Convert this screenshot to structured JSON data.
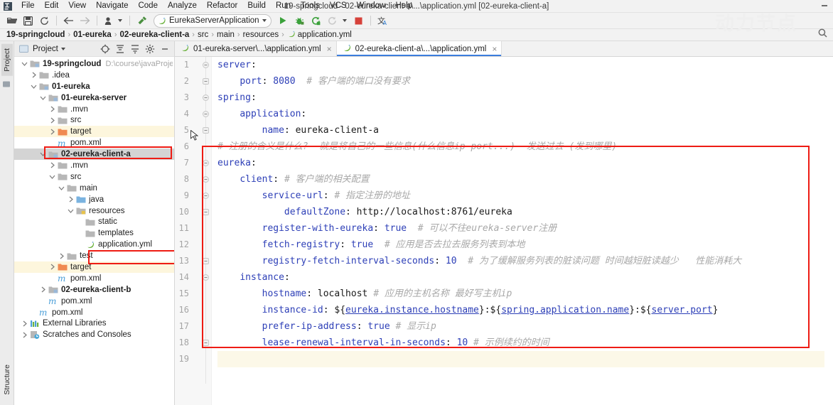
{
  "window": {
    "title": "19-springcloud - 02-eureka-client-a\\...\\application.yml [02-eureka-client-a]",
    "minimize_label": "—"
  },
  "menubar": {
    "items": [
      {
        "label": "File"
      },
      {
        "label": "Edit"
      },
      {
        "label": "View"
      },
      {
        "label": "Navigate"
      },
      {
        "label": "Code"
      },
      {
        "label": "Analyze"
      },
      {
        "label": "Refactor"
      },
      {
        "label": "Build"
      },
      {
        "label": "Run"
      },
      {
        "label": "Tools"
      },
      {
        "label": "VCS"
      },
      {
        "label": "Window"
      },
      {
        "label": "Help"
      }
    ]
  },
  "toolbar": {
    "run_config": "EurekaServerApplication",
    "icons": [
      "open-folder-icon",
      "save-all-icon",
      "sync-icon",
      "back-arrow-icon",
      "forward-arrow-icon",
      "profile-icon",
      "build-hammer-icon",
      "run-icon",
      "debug-icon",
      "run-with-coverage-icon",
      "rerun-icon",
      "stop-icon",
      "translate-icon"
    ]
  },
  "breadcrumb": {
    "items": [
      {
        "label": "19-springcloud",
        "bold": true
      },
      {
        "label": "01-eureka",
        "bold": true
      },
      {
        "label": "02-eureka-client-a",
        "bold": true
      },
      {
        "label": "src",
        "bold": false
      },
      {
        "label": "main",
        "bold": false
      },
      {
        "label": "resources",
        "bold": false
      },
      {
        "label": "application.yml",
        "bold": false,
        "icon": "yml-file-icon"
      }
    ],
    "separator": "›"
  },
  "toolstrip": {
    "project_tab": "Project",
    "structure_tab": "Structure"
  },
  "project_panel": {
    "title": "Project",
    "header_icons": [
      "target-locate-icon",
      "collapse-all-icon",
      "expand-all-icon",
      "gear-icon",
      "minimize-icon"
    ],
    "tree": [
      {
        "indent": 0,
        "arrow": "down",
        "icon": "module-icon",
        "label": "19-springcloud",
        "bold": true,
        "path": "D:\\course\\javaProject\\"
      },
      {
        "indent": 1,
        "arrow": "right",
        "icon": "folder-icon",
        "label": ".idea",
        "bold": false
      },
      {
        "indent": 1,
        "arrow": "down",
        "icon": "module-icon",
        "label": "01-eureka",
        "bold": true
      },
      {
        "indent": 2,
        "arrow": "down",
        "icon": "module-icon",
        "label": "01-eureka-server",
        "bold": true
      },
      {
        "indent": 3,
        "arrow": "right",
        "icon": "folder-icon",
        "label": ".mvn",
        "bold": false
      },
      {
        "indent": 3,
        "arrow": "right",
        "icon": "folder-icon",
        "label": "src",
        "bold": false
      },
      {
        "indent": 3,
        "arrow": "right",
        "icon": "target-folder-icon",
        "label": "target",
        "bold": false,
        "highlight": "yellow"
      },
      {
        "indent": 3,
        "arrow": "none",
        "icon": "maven-icon",
        "label": "pom.xml",
        "bold": false
      },
      {
        "indent": 2,
        "arrow": "down",
        "icon": "module-icon",
        "label": "02-eureka-client-a",
        "bold": true,
        "selected": true
      },
      {
        "indent": 3,
        "arrow": "right",
        "icon": "folder-icon",
        "label": ".mvn",
        "bold": false
      },
      {
        "indent": 3,
        "arrow": "down",
        "icon": "folder-icon",
        "label": "src",
        "bold": false
      },
      {
        "indent": 4,
        "arrow": "down",
        "icon": "folder-icon",
        "label": "main",
        "bold": false
      },
      {
        "indent": 5,
        "arrow": "right",
        "icon": "source-folder-icon",
        "label": "java",
        "bold": false
      },
      {
        "indent": 5,
        "arrow": "down",
        "icon": "resource-folder-icon",
        "label": "resources",
        "bold": false
      },
      {
        "indent": 6,
        "arrow": "none",
        "icon": "folder-icon",
        "label": "static",
        "bold": false
      },
      {
        "indent": 6,
        "arrow": "none",
        "icon": "folder-icon",
        "label": "templates",
        "bold": false
      },
      {
        "indent": 6,
        "arrow": "none",
        "icon": "yml-file-icon",
        "label": "application.yml",
        "bold": false
      },
      {
        "indent": 4,
        "arrow": "right",
        "icon": "folder-icon",
        "label": "test",
        "bold": false
      },
      {
        "indent": 3,
        "arrow": "right",
        "icon": "target-folder-icon",
        "label": "target",
        "bold": false,
        "highlight": "yellow"
      },
      {
        "indent": 3,
        "arrow": "none",
        "icon": "maven-icon",
        "label": "pom.xml",
        "bold": false
      },
      {
        "indent": 2,
        "arrow": "right",
        "icon": "module-icon",
        "label": "02-eureka-client-b",
        "bold": true
      },
      {
        "indent": 2,
        "arrow": "none",
        "icon": "maven-icon",
        "label": "pom.xml",
        "bold": false
      },
      {
        "indent": 1,
        "arrow": "none",
        "icon": "maven-icon",
        "label": "pom.xml",
        "bold": false
      },
      {
        "indent": 0,
        "arrow": "right",
        "icon": "library-icon",
        "label": "External Libraries",
        "bold": false
      },
      {
        "indent": 0,
        "arrow": "right",
        "icon": "scratches-icon",
        "label": "Scratches and Consoles",
        "bold": false
      }
    ]
  },
  "editor": {
    "tabs": [
      {
        "label": "01-eureka-server\\...\\application.yml",
        "icon": "yml-file-icon",
        "active": false,
        "close": "×"
      },
      {
        "label": "02-eureka-client-a\\...\\application.yml",
        "icon": "yml-file-icon",
        "active": true,
        "close": "×"
      }
    ],
    "line_numbers": [
      1,
      2,
      3,
      4,
      5,
      6,
      7,
      8,
      9,
      10,
      11,
      12,
      13,
      14,
      15,
      16,
      17,
      18,
      19
    ],
    "current_line": 19,
    "lines": [
      {
        "n": 1,
        "tokens": [
          {
            "t": "server",
            "c": "k"
          },
          {
            "t": ":",
            "c": "v"
          }
        ]
      },
      {
        "n": 2,
        "tokens": [
          {
            "t": "    ",
            "c": "v"
          },
          {
            "t": "port",
            "c": "k"
          },
          {
            "t": ": ",
            "c": "v"
          },
          {
            "t": "8080",
            "c": "num"
          },
          {
            "t": "  ",
            "c": "v"
          },
          {
            "t": "# ",
            "c": "cmh"
          },
          {
            "t": "客户端的端口没有要求",
            "c": "cm"
          }
        ]
      },
      {
        "n": 3,
        "tokens": [
          {
            "t": "spring",
            "c": "k"
          },
          {
            "t": ":",
            "c": "v"
          }
        ]
      },
      {
        "n": 4,
        "tokens": [
          {
            "t": "    ",
            "c": "v"
          },
          {
            "t": "application",
            "c": "k"
          },
          {
            "t": ":",
            "c": "v"
          }
        ]
      },
      {
        "n": 5,
        "tokens": [
          {
            "t": "        ",
            "c": "v"
          },
          {
            "t": "name",
            "c": "k"
          },
          {
            "t": ": ",
            "c": "v"
          },
          {
            "t": "eureka-client-a",
            "c": "v"
          }
        ]
      },
      {
        "n": 6,
        "tokens": [
          {
            "t": "# ",
            "c": "cmh"
          },
          {
            "t": "注册的含义是什么?  就是将自己的一些信息(什么信息ip port...)  发送过去 (发到哪里)",
            "c": "cm"
          }
        ]
      },
      {
        "n": 7,
        "tokens": [
          {
            "t": "eureka",
            "c": "k"
          },
          {
            "t": ":",
            "c": "v"
          }
        ]
      },
      {
        "n": 8,
        "tokens": [
          {
            "t": "    ",
            "c": "v"
          },
          {
            "t": "client",
            "c": "k"
          },
          {
            "t": ": ",
            "c": "v"
          },
          {
            "t": "# ",
            "c": "cmh"
          },
          {
            "t": "客户端的相关配置",
            "c": "cm"
          }
        ]
      },
      {
        "n": 9,
        "tokens": [
          {
            "t": "        ",
            "c": "v"
          },
          {
            "t": "service-url",
            "c": "k"
          },
          {
            "t": ": ",
            "c": "v"
          },
          {
            "t": "# ",
            "c": "cmh"
          },
          {
            "t": "指定注册的地址",
            "c": "cm"
          }
        ]
      },
      {
        "n": 10,
        "tokens": [
          {
            "t": "            ",
            "c": "v"
          },
          {
            "t": "defaultZone",
            "c": "k"
          },
          {
            "t": ": ",
            "c": "v"
          },
          {
            "t": "http://localhost:8761/eureka",
            "c": "v"
          }
        ]
      },
      {
        "n": 11,
        "tokens": [
          {
            "t": "        ",
            "c": "v"
          },
          {
            "t": "register-with-eureka",
            "c": "k"
          },
          {
            "t": ": ",
            "c": "v"
          },
          {
            "t": "true",
            "c": "num"
          },
          {
            "t": "  ",
            "c": "v"
          },
          {
            "t": "# ",
            "c": "cmh"
          },
          {
            "t": "可以不往eureka-server注册",
            "c": "cm"
          }
        ]
      },
      {
        "n": 12,
        "tokens": [
          {
            "t": "        ",
            "c": "v"
          },
          {
            "t": "fetch-registry",
            "c": "k"
          },
          {
            "t": ": ",
            "c": "v"
          },
          {
            "t": "true",
            "c": "num"
          },
          {
            "t": "  ",
            "c": "v"
          },
          {
            "t": "# ",
            "c": "cmh"
          },
          {
            "t": "应用是否去拉去服务列表到本地",
            "c": "cm"
          }
        ]
      },
      {
        "n": 13,
        "tokens": [
          {
            "t": "        ",
            "c": "v"
          },
          {
            "t": "registry-fetch-interval-seconds",
            "c": "k"
          },
          {
            "t": ": ",
            "c": "v"
          },
          {
            "t": "10",
            "c": "num"
          },
          {
            "t": "  ",
            "c": "v"
          },
          {
            "t": "# ",
            "c": "cmh"
          },
          {
            "t": "为了缓解服务列表的脏读问题 时间越短脏读越少   性能消耗大",
            "c": "cm"
          }
        ]
      },
      {
        "n": 14,
        "tokens": [
          {
            "t": "    ",
            "c": "v"
          },
          {
            "t": "instance",
            "c": "k"
          },
          {
            "t": ":",
            "c": "v"
          }
        ]
      },
      {
        "n": 15,
        "tokens": [
          {
            "t": "        ",
            "c": "v"
          },
          {
            "t": "hostname",
            "c": "k"
          },
          {
            "t": ": ",
            "c": "v"
          },
          {
            "t": "localhost",
            "c": "v"
          },
          {
            "t": " ",
            "c": "v"
          },
          {
            "t": "# ",
            "c": "cmh"
          },
          {
            "t": "应用的主机名称 最好写主机ip",
            "c": "cm"
          }
        ]
      },
      {
        "n": 16,
        "tokens": [
          {
            "t": "        ",
            "c": "v"
          },
          {
            "t": "instance-id",
            "c": "k"
          },
          {
            "t": ": ",
            "c": "v"
          },
          {
            "t": "${",
            "c": "v"
          },
          {
            "t": "eureka.instance.hostname",
            "c": "lnk"
          },
          {
            "t": "}:${",
            "c": "v"
          },
          {
            "t": "spring.application.name",
            "c": "lnk"
          },
          {
            "t": "}:${",
            "c": "v"
          },
          {
            "t": "server.port",
            "c": "lnk"
          },
          {
            "t": "}",
            "c": "v"
          }
        ]
      },
      {
        "n": 17,
        "tokens": [
          {
            "t": "        ",
            "c": "v"
          },
          {
            "t": "prefer-ip-address",
            "c": "k"
          },
          {
            "t": ": ",
            "c": "v"
          },
          {
            "t": "true",
            "c": "num"
          },
          {
            "t": " ",
            "c": "v"
          },
          {
            "t": "# ",
            "c": "cmh"
          },
          {
            "t": "显示ip",
            "c": "cm"
          }
        ]
      },
      {
        "n": 18,
        "tokens": [
          {
            "t": "        ",
            "c": "v"
          },
          {
            "t": "lease-renewal-interval-in-seconds",
            "c": "k"
          },
          {
            "t": ": ",
            "c": "v"
          },
          {
            "t": "10",
            "c": "num"
          },
          {
            "t": " ",
            "c": "v"
          },
          {
            "t": "# ",
            "c": "cmh"
          },
          {
            "t": "示例续约的时间",
            "c": "cm"
          }
        ]
      },
      {
        "n": 19,
        "tokens": []
      }
    ]
  },
  "watermark": {
    "text": "动力节点"
  },
  "colors": {
    "accent_blue": "#3b7ddd",
    "key_blue": "#2d3fb7",
    "comment_gray": "#a8a8a8",
    "annotation_red": "#ee1c14",
    "highlight_yellow": "#fdf6dd",
    "selection_gray": "#d4d4d4"
  }
}
